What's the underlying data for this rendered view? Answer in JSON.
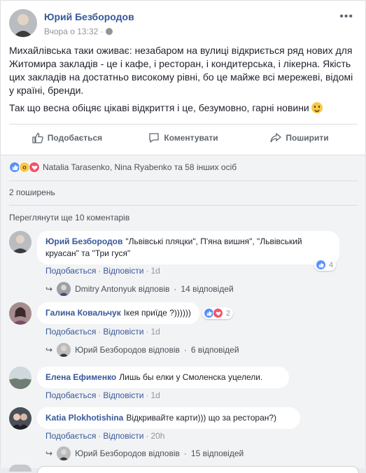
{
  "post": {
    "author": "Юрий Безбородов",
    "time": "Вчора о 13:32 ·",
    "more_icon": "more-horizontal-icon",
    "text": [
      "Михайлівська таки оживає: незабаром на вулиці відкриється ряд нових для Житомира закладів - це і кафе, і ресторан, і кондитерська, і лікерна. Якість цих закладів на достатньо високому рівні, бо це майже всі мережеві, відомі у країні, бренди.",
      "Так що весна обіцяє цікаві відкриття і це, безумовно, гарні новини"
    ]
  },
  "actions": {
    "like": "Подобається",
    "comment": "Коментувати",
    "share": "Поширити"
  },
  "reactions": {
    "text": "Natalia Tarasenko, Nina Ryabenko та 58 інших осіб"
  },
  "shares": "2 поширень",
  "view_more": "Переглянути ще 10 коментарів",
  "comments": [
    {
      "author": "Юрий Безбородов",
      "text": "\"Львівські пляцки\", П'яна вишня\", \"Львівський круасан\" та \"Три гуся\"",
      "like": "Подобається",
      "reply": "Відповісти",
      "age": "1d",
      "reactions_count": "4",
      "reply_author": "Dmitry Antonyuk відповів",
      "reply_count": "14 відповідей"
    },
    {
      "author": "Галина Ковальчук",
      "text": "Ікея приїде ?))))))",
      "like": "Подобається",
      "reply": "Відповісти",
      "age": "1d",
      "reactions_count": "2",
      "reply_author": "Юрий Безбородов відповів",
      "reply_count": "6 відповідей"
    },
    {
      "author": "Елена Ефименко",
      "text": "Лишь бы елки у Смоленска уцелели.",
      "like": "Подобається",
      "reply": "Відповісти",
      "age": "1d"
    },
    {
      "author": "Katia Plokhotishina",
      "text": "Відкривайте карти))) що за ресторан?)",
      "like": "Подобається",
      "reply": "Відповісти",
      "age": "20h",
      "reply_author": "Юрий Безбородов відповів",
      "reply_count": "15 відповідей"
    }
  ],
  "colors": {
    "link": "#385898",
    "muted": "#90949c",
    "like_blue": "#5890ff",
    "love_red": "#f25268"
  }
}
